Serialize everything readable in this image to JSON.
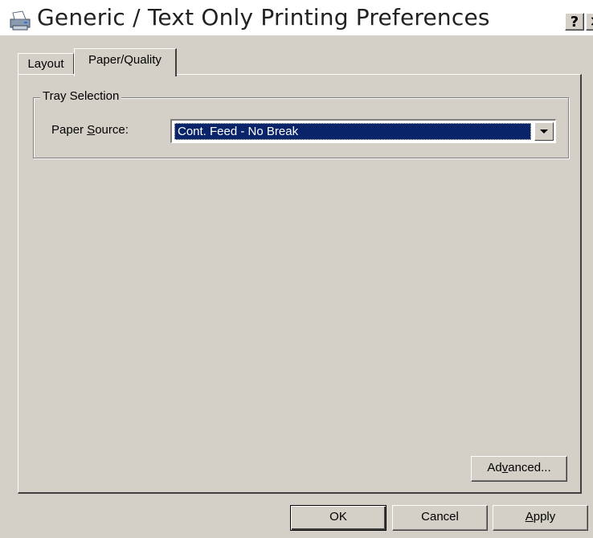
{
  "window": {
    "title": "Generic / Text Only Printing Preferences",
    "title_icon": "printer-icon",
    "help_glyph": "?",
    "close_glyph": "✕"
  },
  "tabs": [
    {
      "label": "Layout",
      "selected": false
    },
    {
      "label": "Paper/Quality",
      "selected": true
    }
  ],
  "tray_selection": {
    "group_label": "Tray Selection",
    "paper_source_label": {
      "before": "Paper ",
      "mnemonic": "S",
      "after": "ource:"
    },
    "paper_source_value": "Cont. Feed - No Break"
  },
  "buttons": {
    "advanced": {
      "before": "Ad",
      "mnemonic": "v",
      "after": "anced..."
    },
    "ok": "OK",
    "cancel": "Cancel",
    "apply": {
      "before": "",
      "mnemonic": "A",
      "after": "pply"
    }
  },
  "colors": {
    "dialog_bg": "#d4d0c8",
    "selection": "#0a246a"
  }
}
